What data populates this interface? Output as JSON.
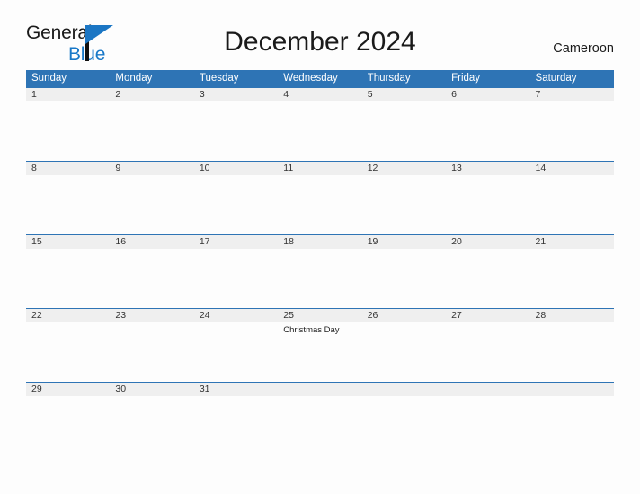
{
  "brand": {
    "line1": "General",
    "line2": "Blue",
    "flag_icon": "blue-flag-triangle",
    "accent_color": "#1878c8"
  },
  "header": {
    "title": "December 2024",
    "location": "Cameroon"
  },
  "theme": {
    "header_blue": "#2e74b5",
    "date_band_gray": "#efefef",
    "page_background": "#fdfdfd",
    "text_dark": "#1a1a1a"
  },
  "calendar": {
    "weekday_headers": [
      "Sunday",
      "Monday",
      "Tuesday",
      "Wednesday",
      "Thursday",
      "Friday",
      "Saturday"
    ],
    "weeks": [
      {
        "days": [
          {
            "date": "1",
            "events": []
          },
          {
            "date": "2",
            "events": []
          },
          {
            "date": "3",
            "events": []
          },
          {
            "date": "4",
            "events": []
          },
          {
            "date": "5",
            "events": []
          },
          {
            "date": "6",
            "events": []
          },
          {
            "date": "7",
            "events": []
          }
        ]
      },
      {
        "days": [
          {
            "date": "8",
            "events": []
          },
          {
            "date": "9",
            "events": []
          },
          {
            "date": "10",
            "events": []
          },
          {
            "date": "11",
            "events": []
          },
          {
            "date": "12",
            "events": []
          },
          {
            "date": "13",
            "events": []
          },
          {
            "date": "14",
            "events": []
          }
        ]
      },
      {
        "days": [
          {
            "date": "15",
            "events": []
          },
          {
            "date": "16",
            "events": []
          },
          {
            "date": "17",
            "events": []
          },
          {
            "date": "18",
            "events": []
          },
          {
            "date": "19",
            "events": []
          },
          {
            "date": "20",
            "events": []
          },
          {
            "date": "21",
            "events": []
          }
        ]
      },
      {
        "days": [
          {
            "date": "22",
            "events": []
          },
          {
            "date": "23",
            "events": []
          },
          {
            "date": "24",
            "events": []
          },
          {
            "date": "25",
            "events": [
              "Christmas Day"
            ]
          },
          {
            "date": "26",
            "events": []
          },
          {
            "date": "27",
            "events": []
          },
          {
            "date": "28",
            "events": []
          }
        ]
      },
      {
        "days": [
          {
            "date": "29",
            "events": []
          },
          {
            "date": "30",
            "events": []
          },
          {
            "date": "31",
            "events": []
          },
          {
            "date": "",
            "events": []
          },
          {
            "date": "",
            "events": []
          },
          {
            "date": "",
            "events": []
          },
          {
            "date": "",
            "events": []
          }
        ]
      }
    ]
  }
}
